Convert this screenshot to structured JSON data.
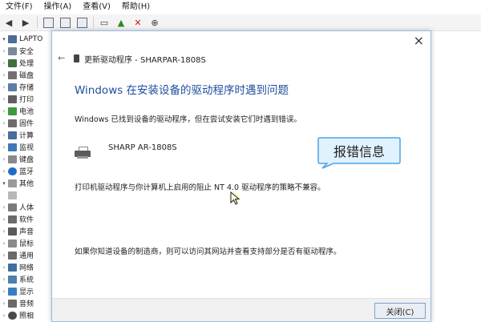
{
  "menubar": {
    "items": [
      "文件(F)",
      "操作(A)",
      "查看(V)",
      "帮助(H)"
    ]
  },
  "toolbar": {
    "icons": [
      "back-arrow-icon",
      "forward-arrow-icon",
      "properties-icon",
      "help-icon",
      "view-icon",
      "monitor-icon",
      "update-driver-icon",
      "uninstall-icon",
      "download-icon"
    ]
  },
  "tree": {
    "root": "LAPTO",
    "items": [
      "安全",
      "处理",
      "磁盘",
      "存储",
      "打印",
      "电池",
      "固件",
      "计算",
      "监视",
      "键盘",
      "蓝牙",
      "其他",
      "",
      "人体",
      "软件",
      "声音",
      "鼠标",
      "通用",
      "网络",
      "系统",
      "显示",
      "音频",
      "照相"
    ]
  },
  "dialog": {
    "title": "更新驱动程序 - SHARPAR-1808S",
    "heading": "Windows 在安装设备的驱动程序时遇到问题",
    "description": "Windows 已找到设备的驱动程序，但在尝试安装它们时遇到错误。",
    "device_name": "SHARP AR-1808S",
    "error_message": "打印机驱动程序与你计算机上启用的阻止 NT 4.0 驱动程序的策略不兼容。",
    "info_message": "如果你知道设备的制造商，则可以访问其网站并查看支持部分是否有驱动程序。",
    "close_label": "关闭(C)",
    "close_x": "×"
  },
  "callout": {
    "text": "报错信息"
  },
  "colors": {
    "heading": "#1e4e9c",
    "callout_fill": "#dff2fd",
    "callout_border": "#4aa3e8"
  }
}
